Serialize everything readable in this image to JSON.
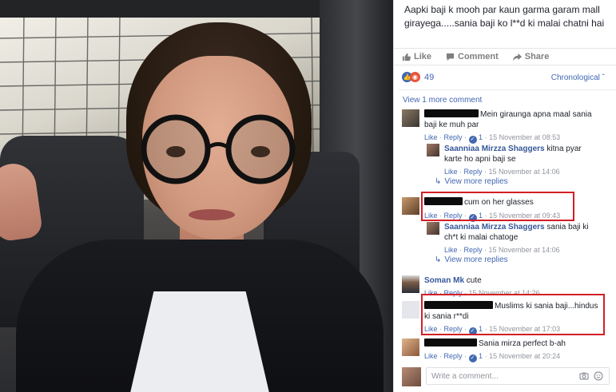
{
  "post": {
    "text": "Aapki baji k mooh par kaun garma garam mall girayega.....sania baji ko l**d ki malai chatni hai"
  },
  "actions": {
    "like": "Like",
    "comment": "Comment",
    "share": "Share"
  },
  "reactions": {
    "count": "49",
    "order": "Chronological ˇ"
  },
  "view_more_comment": "View 1 more comment",
  "comments": [
    {
      "text": "Mein giraunga apna maal sania baji ke muh par",
      "like": "Like",
      "reply": "Reply",
      "reaction_count": "1",
      "time": "15 November at 08:53"
    },
    {
      "name": "Saanniaa Mirzza Shaggers",
      "text": "kitna pyar karte ho apni baji se",
      "like": "Like",
      "reply": "Reply",
      "time": "15 November at 14:06"
    },
    {
      "text": "cum on her glasses",
      "like": "Like",
      "reply": "Reply",
      "reaction_count": "1",
      "time": "15 November at 09:43"
    },
    {
      "name": "Saanniaa Mirzza Shaggers",
      "text": "sania baji ki ch*t ki malai chatoge",
      "like": "Like",
      "reply": "Reply",
      "time": "15 November at 14:06"
    },
    {
      "name": "Soman Mk",
      "text": "cute",
      "like": "Like",
      "reply": "Reply",
      "time": "15 November at 14:26"
    },
    {
      "text": "Muslims ki sania baji...hindus ki sania r**di",
      "like": "Like",
      "reply": "Reply",
      "reaction_count": "1",
      "time": "15 November at 17:03"
    },
    {
      "text": "Sania mirza perfect b-ah",
      "like": "Like",
      "reply": "Reply",
      "reaction_count": "1",
      "time": "15 November at 20:24"
    }
  ],
  "view_more_replies": "View more replies",
  "write_comment": {
    "placeholder": "Write a comment..."
  },
  "colors": {
    "link": "#4267b2",
    "name": "#365899",
    "highlight": "#d31f26"
  }
}
